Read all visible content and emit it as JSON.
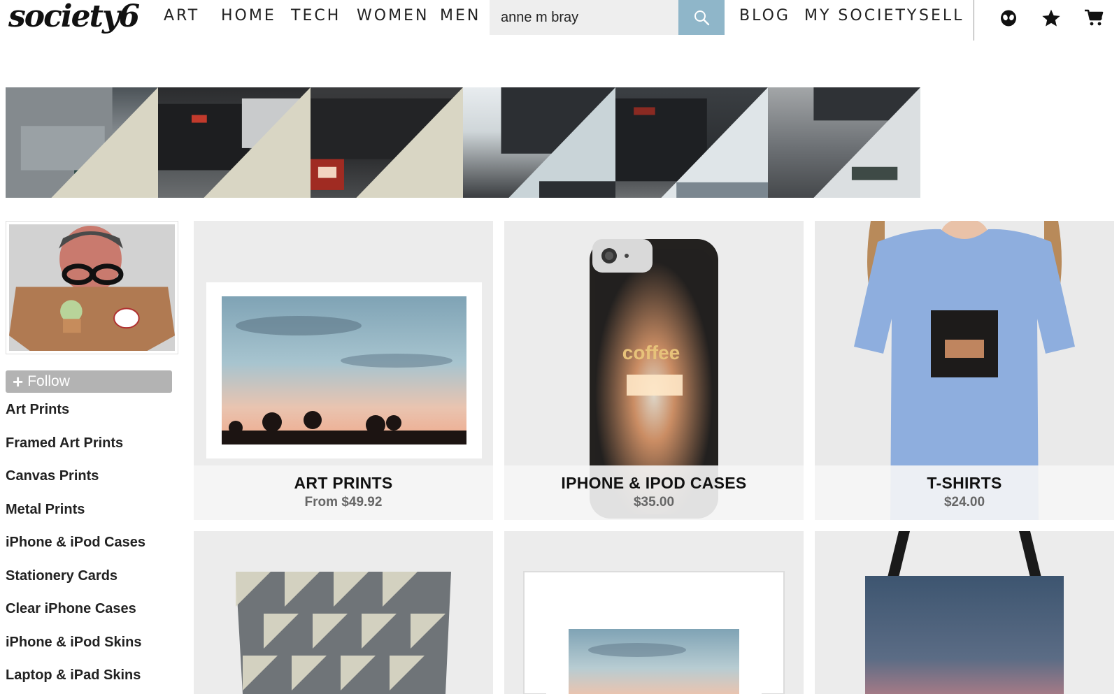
{
  "brand": {
    "logo": "society6"
  },
  "nav": {
    "left": [
      "ART",
      "HOME",
      "TECH",
      "WOMEN",
      "MEN"
    ],
    "right": [
      "BLOG",
      "MY SOCIETY",
      "SELL"
    ]
  },
  "search": {
    "value": "anne m bray",
    "icon": "search-icon"
  },
  "header_icons": [
    "alien-icon",
    "star-icon",
    "cart-icon"
  ],
  "profile": {
    "follow_label": "Follow"
  },
  "sidebar": {
    "items": [
      "Art Prints",
      "Framed Art Prints",
      "Canvas Prints",
      "Metal Prints",
      "iPhone & iPod Cases",
      "Stationery Cards",
      "Clear iPhone Cases",
      "iPhone & iPod Skins",
      "Laptop & iPad Skins"
    ]
  },
  "products": [
    {
      "title": "ART PRINTS",
      "price": "From $49.92"
    },
    {
      "title": "IPHONE & IPOD CASES",
      "price": "$35.00"
    },
    {
      "title": "T-SHIRTS",
      "price": "$24.00"
    }
  ],
  "phone_case_art_text": "coffee",
  "colors": {
    "search_button": "#8fb6c9",
    "follow_button": "#b3b3b3",
    "tshirt": "#8eaede"
  }
}
